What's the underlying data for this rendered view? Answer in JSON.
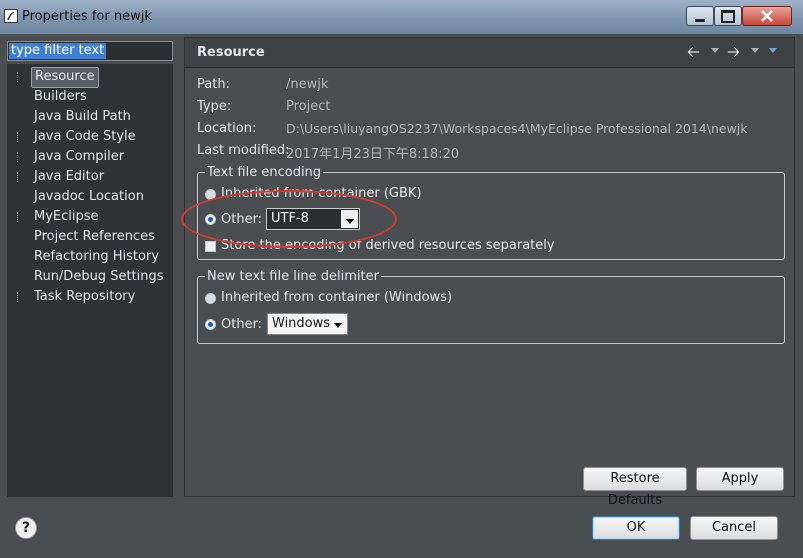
{
  "window": {
    "title": "Properties for newjk"
  },
  "filter": {
    "value": "type filter text"
  },
  "tree": [
    {
      "label": "Resource",
      "expandable": true,
      "selected": true
    },
    {
      "label": "Builders",
      "expandable": false
    },
    {
      "label": "Java Build Path",
      "expandable": false
    },
    {
      "label": "Java Code Style",
      "expandable": true
    },
    {
      "label": "Java Compiler",
      "expandable": true
    },
    {
      "label": "Java Editor",
      "expandable": true
    },
    {
      "label": "Javadoc Location",
      "expandable": false
    },
    {
      "label": "MyEclipse",
      "expandable": true
    },
    {
      "label": "Project References",
      "expandable": false
    },
    {
      "label": "Refactoring History",
      "expandable": false
    },
    {
      "label": "Run/Debug Settings",
      "expandable": false
    },
    {
      "label": "Task Repository",
      "expandable": true
    }
  ],
  "page": {
    "title": "Resource",
    "props": [
      {
        "key": "Path:",
        "value": "/newjk"
      },
      {
        "key": "Type:",
        "value": "Project"
      },
      {
        "key": "Location:",
        "value": "D:\\Users\\liuyangOS2237\\Workspaces4\\MyEclipse Professional 2014\\newjk"
      },
      {
        "key": "Last modified:",
        "value": "2017年1月23日下午8:18:20"
      }
    ]
  },
  "encoding": {
    "label": "Text file encoding",
    "inherited": "Inherited from container (GBK)",
    "other": "Other:",
    "other_value": "UTF-8",
    "store_label": "Store the encoding of derived resources separately"
  },
  "delimiter": {
    "label": "New text file line delimiter",
    "inherited": "Inherited from container (Windows)",
    "other": "Other:",
    "other_value": "Windows"
  },
  "buttons": {
    "restore": "Restore Defaults",
    "apply": "Apply",
    "ok": "OK",
    "cancel": "Cancel",
    "help": "?"
  },
  "colors": {
    "annotation": "#d23a33",
    "background": "#4a4e51"
  }
}
